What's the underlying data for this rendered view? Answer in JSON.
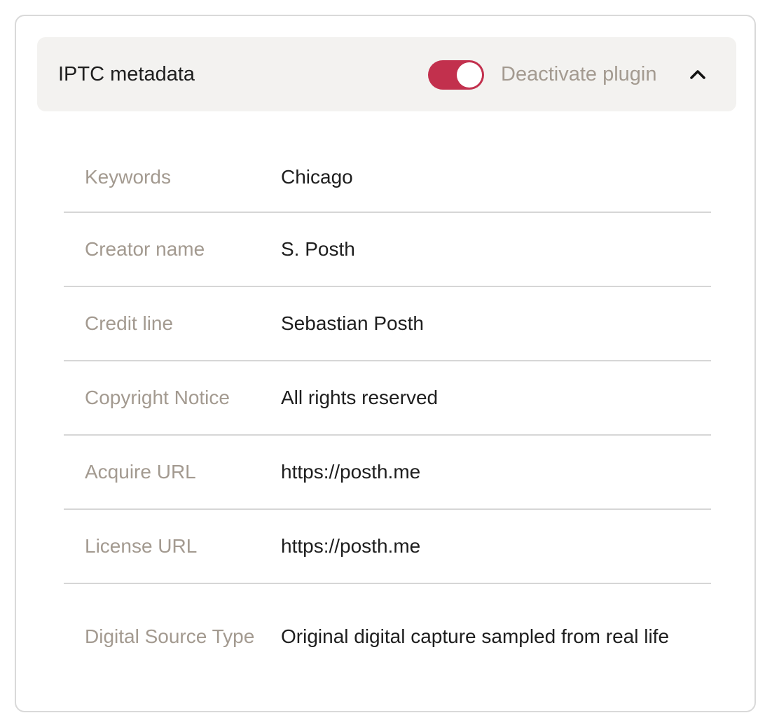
{
  "header": {
    "title": "IPTC metadata",
    "toggle_on": true,
    "action_label": "Deactivate plugin",
    "collapse_icon": "chevron-up-icon"
  },
  "colors": {
    "accent": "#c2304d",
    "header_bg": "#f3f2f0",
    "label_text": "#a39a90",
    "value_text": "#1e1e1e"
  },
  "metadata": [
    {
      "label": "Keywords",
      "value": "Chicago"
    },
    {
      "label": "Creator name",
      "value": "S. Posth"
    },
    {
      "label": "Credit line",
      "value": "Sebastian Posth"
    },
    {
      "label": "Copyright Notice",
      "value": "All rights reserved"
    },
    {
      "label": "Acquire URL",
      "value": "https://posth.me"
    },
    {
      "label": "License URL",
      "value": "https://posth.me"
    },
    {
      "label": "Digital Source Type",
      "value": "Original digital capture sampled from real life"
    }
  ]
}
